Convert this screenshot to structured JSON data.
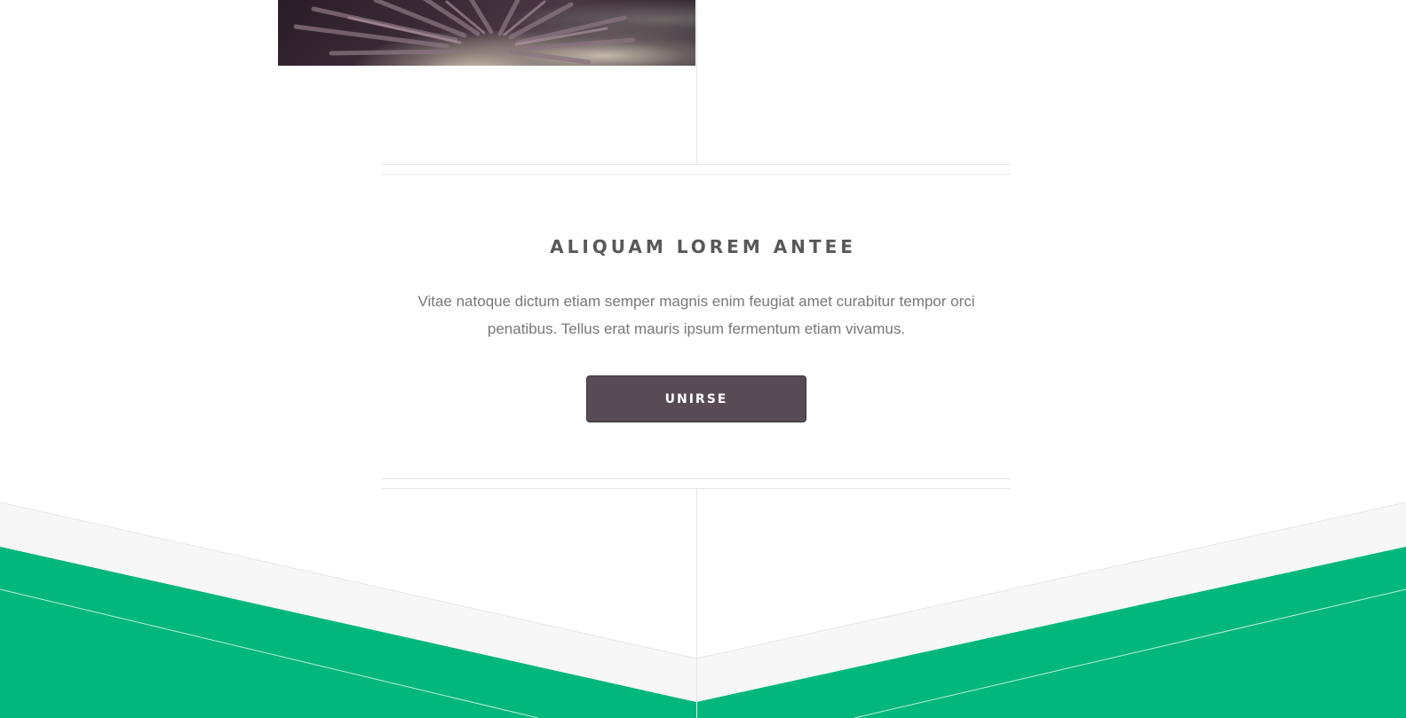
{
  "hero_image": {
    "alt": "sea urchin close-up",
    "icon": "photo"
  },
  "cta": {
    "title": "ALIQUAM LOREM ANTEE",
    "text_line1": "Vitae natoque dictum etiam semper magnis enim feugiat amet curabitur tempor orci",
    "text_line2": "penatibus. Tellus erat mauris ipsum fermentum etiam vivamus.",
    "button_label": "UNIRSE"
  },
  "colors": {
    "accent_green": "#02b77b",
    "button_bg": "#584b56",
    "title_text": "#585858",
    "body_text": "#777777",
    "divider": "#e6e6e6",
    "band_light": "#f7f7f7"
  }
}
